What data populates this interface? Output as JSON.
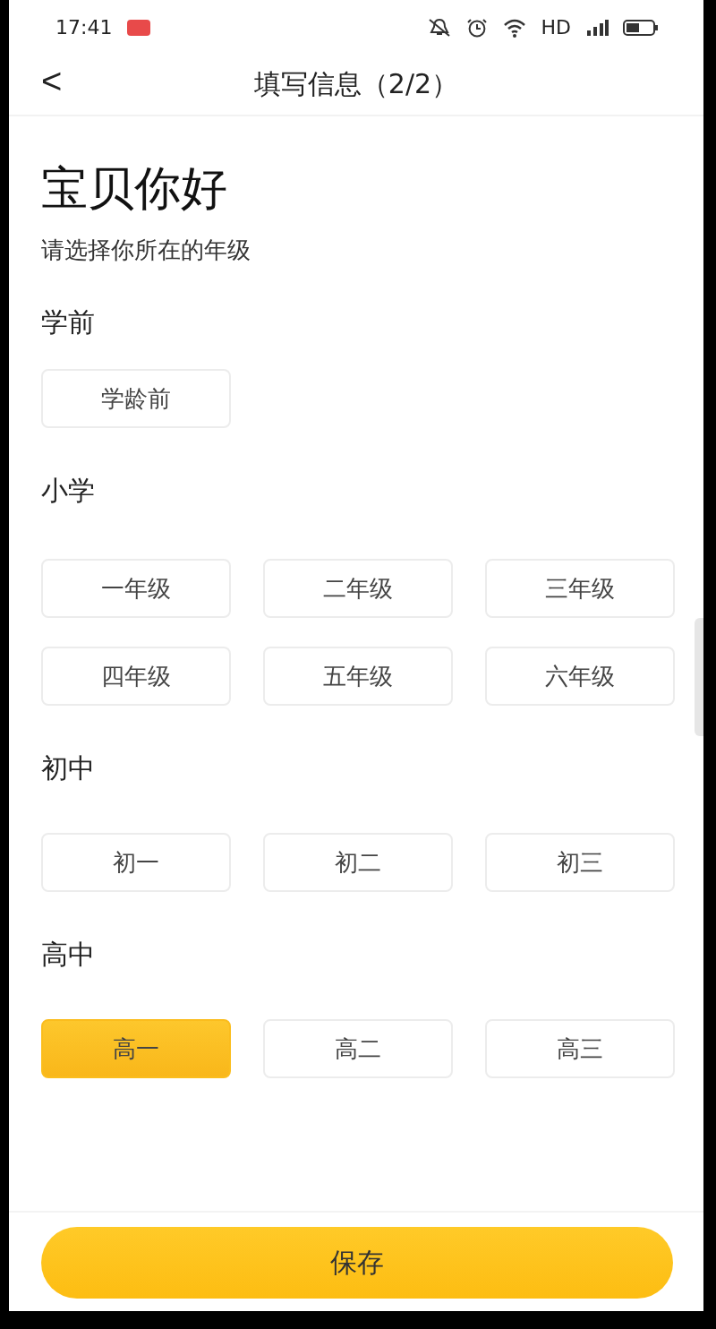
{
  "status_bar": {
    "time": "17:41",
    "network": "HD"
  },
  "header": {
    "back": "<",
    "title": "填写信息（2/2）"
  },
  "greeting": "宝贝你好",
  "subtitle": "请选择你所在的年级",
  "sections": [
    {
      "title": "学前",
      "grades": [
        {
          "label": "学龄前",
          "selected": false
        }
      ]
    },
    {
      "title": "小学",
      "grades": [
        {
          "label": "一年级",
          "selected": false
        },
        {
          "label": "二年级",
          "selected": false
        },
        {
          "label": "三年级",
          "selected": false
        },
        {
          "label": "四年级",
          "selected": false
        },
        {
          "label": "五年级",
          "selected": false
        },
        {
          "label": "六年级",
          "selected": false
        }
      ]
    },
    {
      "title": "初中",
      "grades": [
        {
          "label": "初一",
          "selected": false
        },
        {
          "label": "初二",
          "selected": false
        },
        {
          "label": "初三",
          "selected": false
        }
      ]
    },
    {
      "title": "高中",
      "grades": [
        {
          "label": "高一",
          "selected": true
        },
        {
          "label": "高二",
          "selected": false
        },
        {
          "label": "高三",
          "selected": false
        }
      ]
    }
  ],
  "save_button": "保存"
}
